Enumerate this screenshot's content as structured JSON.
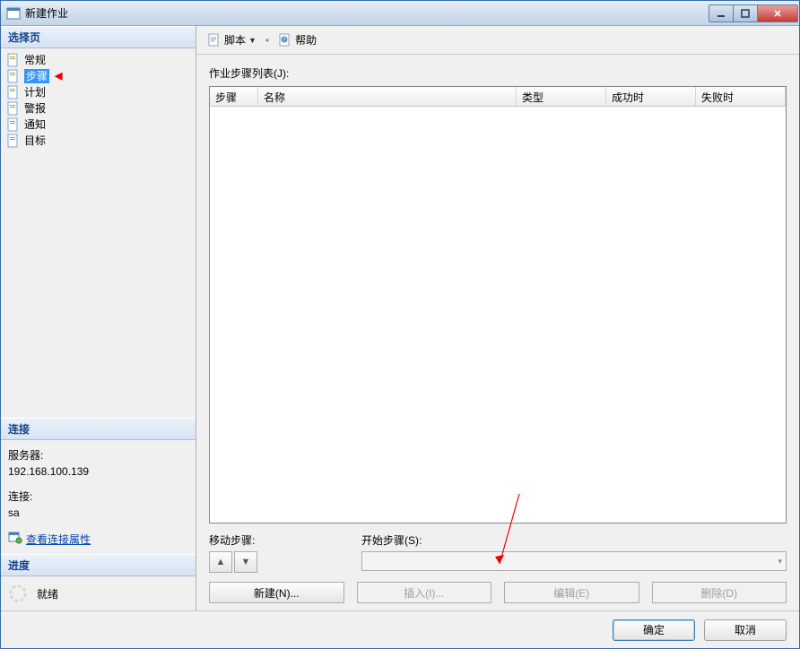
{
  "window": {
    "title": "新建作业"
  },
  "sidebar": {
    "header": "选择页",
    "items": [
      {
        "label": "常规",
        "icon": "page-icon"
      },
      {
        "label": "步骤",
        "icon": "page-icon",
        "selected": true,
        "marked": true
      },
      {
        "label": "计划",
        "icon": "page-icon"
      },
      {
        "label": "警报",
        "icon": "page-icon"
      },
      {
        "label": "通知",
        "icon": "page-icon"
      },
      {
        "label": "目标",
        "icon": "page-icon"
      }
    ]
  },
  "connection": {
    "header": "连接",
    "server_label": "服务器:",
    "server_value": "192.168.100.139",
    "conn_label": "连接:",
    "conn_value": "sa",
    "view_props": "查看连接属性"
  },
  "progress": {
    "header": "进度",
    "status": "就绪"
  },
  "toolbar": {
    "script": "脚本",
    "help": "帮助"
  },
  "main": {
    "list_label": "作业步骤列表(J):",
    "columns": {
      "step": "步骤",
      "name": "名称",
      "type": "类型",
      "on_success": "成功时",
      "on_fail": "失败时"
    },
    "move_label": "移动步骤:",
    "start_label": "开始步骤(S):",
    "buttons": {
      "new": "新建(N)...",
      "insert": "插入(I)...",
      "edit": "编辑(E)",
      "delete": "删除(D)"
    }
  },
  "footer": {
    "ok": "确定",
    "cancel": "取消"
  }
}
